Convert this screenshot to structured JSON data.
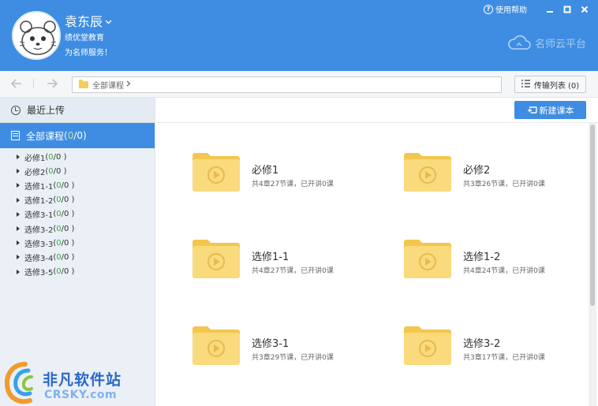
{
  "header": {
    "user_name": "袁东辰",
    "org": "绩优堂教育",
    "motto": "为名师服务！",
    "help": "使用帮助",
    "brand": "名师云平台"
  },
  "toolbar": {
    "path": "全部课程",
    "transfer_label": "传输列表 (0)"
  },
  "sidebar": {
    "recent": "最近上传",
    "all_label": "全部课程",
    "all_done": "0",
    "all_total": "/0)",
    "all_open": " (",
    "items": [
      {
        "name": "必修1",
        "open": " ( ",
        "done": "0",
        "rest": "/0 )"
      },
      {
        "name": "必修2",
        "open": " ( ",
        "done": "0",
        "rest": "/0 )"
      },
      {
        "name": "选修1-1",
        "open": " ( ",
        "done": "0",
        "rest": "/0 )"
      },
      {
        "name": "选修1-2",
        "open": " ( ",
        "done": "0",
        "rest": "/0 )"
      },
      {
        "name": "选修3-1",
        "open": " ( ",
        "done": "0",
        "rest": "/0 )"
      },
      {
        "name": "选修3-2",
        "open": " ( ",
        "done": "0",
        "rest": "/0 )"
      },
      {
        "name": "选修3-3",
        "open": " ( ",
        "done": "0",
        "rest": "/0 )"
      },
      {
        "name": "选修3-4",
        "open": " ( ",
        "done": "0",
        "rest": "/0 )"
      },
      {
        "name": "选修3-5",
        "open": " ( ",
        "done": "0",
        "rest": "/0 )"
      }
    ]
  },
  "main": {
    "new_button": "新建课本",
    "courses": [
      {
        "title": "必修1",
        "meta": "共4章27节课，已开讲0课"
      },
      {
        "title": "必修2",
        "meta": "共3章26节课，已开讲0课"
      },
      {
        "title": "选修1-1",
        "meta": "共4章27节课，已开讲0课"
      },
      {
        "title": "选修1-2",
        "meta": "共4章24节课，已开讲0课"
      },
      {
        "title": "选修3-1",
        "meta": "共3章29节课，已开讲0课"
      },
      {
        "title": "选修3-2",
        "meta": "共3章17节课，已开讲0课"
      }
    ]
  },
  "watermark": {
    "line1": "非凡软件站",
    "line2": "CRSKY.com"
  },
  "colors": {
    "accent": "#3e8de2",
    "folder": "#f6cd5c",
    "count_green": "#3aa63a"
  }
}
